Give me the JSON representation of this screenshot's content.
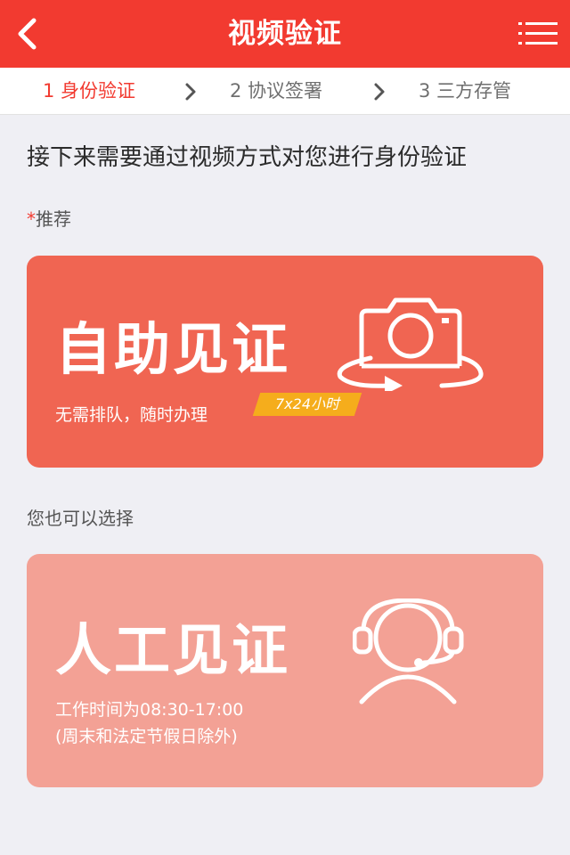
{
  "header": {
    "title": "视频验证",
    "back_icon": "chevron-left-icon",
    "menu_icon": "list-menu-icon",
    "color": "#f23a30"
  },
  "steps": [
    {
      "label": "1 身份验证",
      "active": true
    },
    {
      "label": "2 协议签署",
      "active": false
    },
    {
      "label": "3 三方存管",
      "active": false
    }
  ],
  "main": {
    "intro": "接下来需要通过视频方式对您进行身份验证",
    "recommend_star": "*",
    "recommend_label": "推荐",
    "alt_label": "您也可以选择"
  },
  "cards": {
    "self": {
      "title": "自助见证",
      "subtitle": "无需排队，随时办理",
      "badge": "7x24小时",
      "icon": "camera-rotate-icon",
      "color": "#f06552"
    },
    "manual": {
      "title": "人工见证",
      "hours": "工作时间为08:30-17:00",
      "note": "(周末和法定节假日除外)",
      "icon": "headset-agent-icon",
      "color": "#f3a195"
    }
  }
}
